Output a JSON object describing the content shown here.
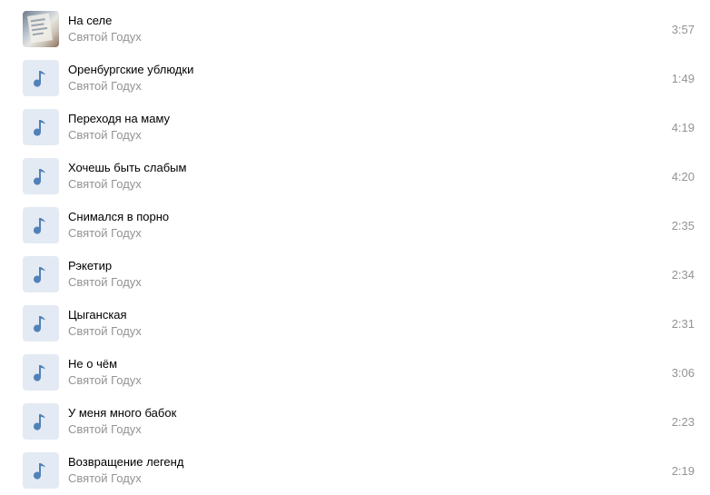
{
  "tracks": [
    {
      "title": "На селе",
      "artist": "Святой Годух",
      "duration": "3:57",
      "cover": "photo-cover"
    },
    {
      "title": "Оренбургские ублюдки",
      "artist": "Святой Годух",
      "duration": "1:49",
      "cover": "music-note-icon"
    },
    {
      "title": "Переходя на маму",
      "artist": "Святой Годух",
      "duration": "4:19",
      "cover": "music-note-icon"
    },
    {
      "title": "Хочешь быть слабым",
      "artist": "Святой Годух",
      "duration": "4:20",
      "cover": "music-note-icon"
    },
    {
      "title": "Снимался в порно",
      "artist": "Святой Годух",
      "duration": "2:35",
      "cover": "music-note-icon"
    },
    {
      "title": "Рэкетир",
      "artist": "Святой Годух",
      "duration": "2:34",
      "cover": "music-note-icon"
    },
    {
      "title": "Цыганская",
      "artist": "Святой Годух",
      "duration": "2:31",
      "cover": "music-note-icon"
    },
    {
      "title": "Не о чём",
      "artist": "Святой Годух",
      "duration": "3:06",
      "cover": "music-note-icon"
    },
    {
      "title": "У меня много бабок",
      "artist": "Святой Годух",
      "duration": "2:23",
      "cover": "music-note-icon"
    },
    {
      "title": "Возвращение легенд",
      "artist": "Святой Годух",
      "duration": "2:19",
      "cover": "music-note-icon"
    }
  ],
  "colors": {
    "title": "#000000",
    "secondary": "#939393",
    "cover_bg": "#e3eaf3",
    "note": "#5181b8"
  }
}
